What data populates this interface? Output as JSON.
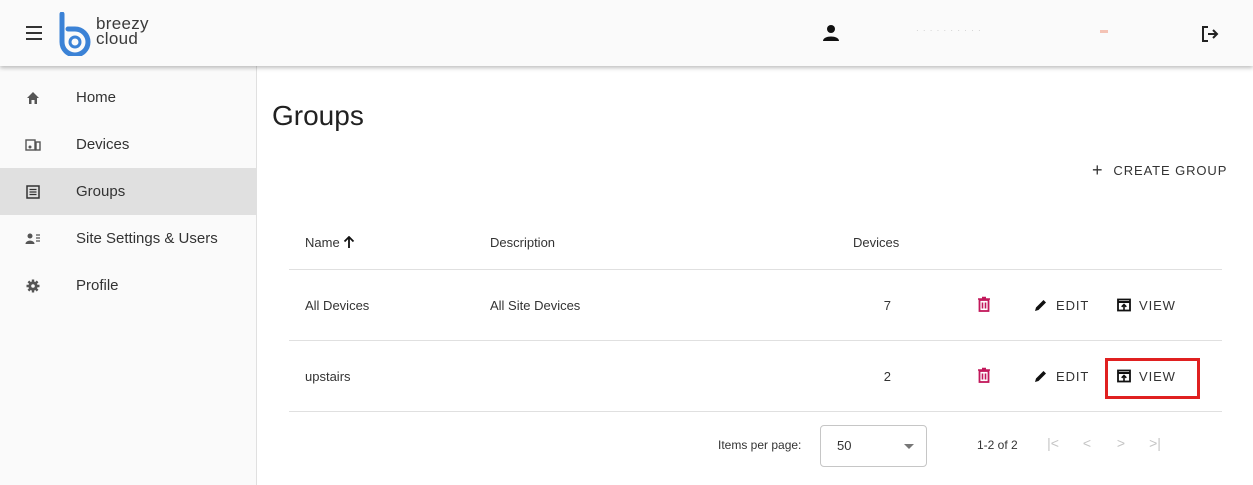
{
  "brand": {
    "line1": "breezy",
    "line2": "cloud"
  },
  "header": {
    "user_name": "· · · · · · · · · ·"
  },
  "sidebar": {
    "items": [
      {
        "label": "Home",
        "icon": "home-icon"
      },
      {
        "label": "Devices",
        "icon": "devices-icon"
      },
      {
        "label": "Groups",
        "icon": "groups-icon",
        "active": true
      },
      {
        "label": "Site Settings & Users",
        "icon": "users-settings-icon"
      },
      {
        "label": "Profile",
        "icon": "gear-icon"
      }
    ]
  },
  "page": {
    "title": "Groups",
    "create_label": "CREATE GROUP",
    "create_plus": "+"
  },
  "table": {
    "headers": {
      "name": "Name",
      "description": "Description",
      "devices": "Devices"
    },
    "sort_arrow": "🡑",
    "rows": [
      {
        "name": "All Devices",
        "description": "All Site Devices",
        "devices": "7",
        "edit": "EDIT",
        "view": "VIEW"
      },
      {
        "name": "upstairs",
        "description": "",
        "devices": "2",
        "edit": "EDIT",
        "view": "VIEW"
      }
    ]
  },
  "paginator": {
    "items_per_page_label": "Items per page:",
    "items_per_page_value": "50",
    "range": "1-2 of 2",
    "first": "|<",
    "prev": "<",
    "next": ">",
    "last": ">|"
  },
  "colors": {
    "accent": "#3b6fc4",
    "danger": "#c2185b",
    "highlight": "#e02020"
  }
}
